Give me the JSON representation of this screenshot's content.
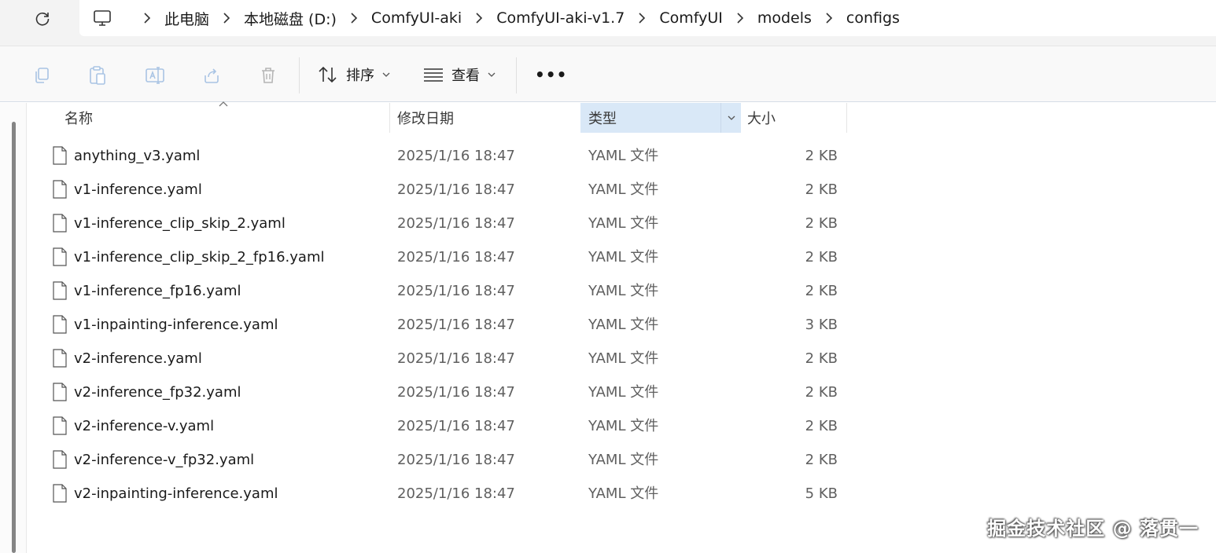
{
  "address_bar": {
    "breadcrumbs": [
      "此电脑",
      "本地磁盘 (D:)",
      "ComfyUI-aki",
      "ComfyUI-aki-v1.7",
      "ComfyUI",
      "models",
      "configs"
    ]
  },
  "toolbar": {
    "icons": [
      "copy-icon",
      "paste-icon",
      "rename-icon",
      "share-icon",
      "delete-icon"
    ],
    "sort_label": "排序",
    "view_label": "查看",
    "more_label": "•••"
  },
  "columns": {
    "name": "名称",
    "date": "修改日期",
    "type": "类型",
    "size": "大小"
  },
  "files": [
    {
      "name": "anything_v3.yaml",
      "date": "2025/1/16 18:47",
      "type": "YAML 文件",
      "size": "2 KB"
    },
    {
      "name": "v1-inference.yaml",
      "date": "2025/1/16 18:47",
      "type": "YAML 文件",
      "size": "2 KB"
    },
    {
      "name": "v1-inference_clip_skip_2.yaml",
      "date": "2025/1/16 18:47",
      "type": "YAML 文件",
      "size": "2 KB"
    },
    {
      "name": "v1-inference_clip_skip_2_fp16.yaml",
      "date": "2025/1/16 18:47",
      "type": "YAML 文件",
      "size": "2 KB"
    },
    {
      "name": "v1-inference_fp16.yaml",
      "date": "2025/1/16 18:47",
      "type": "YAML 文件",
      "size": "2 KB"
    },
    {
      "name": "v1-inpainting-inference.yaml",
      "date": "2025/1/16 18:47",
      "type": "YAML 文件",
      "size": "3 KB"
    },
    {
      "name": "v2-inference.yaml",
      "date": "2025/1/16 18:47",
      "type": "YAML 文件",
      "size": "2 KB"
    },
    {
      "name": "v2-inference_fp32.yaml",
      "date": "2025/1/16 18:47",
      "type": "YAML 文件",
      "size": "2 KB"
    },
    {
      "name": "v2-inference-v.yaml",
      "date": "2025/1/16 18:47",
      "type": "YAML 文件",
      "size": "2 KB"
    },
    {
      "name": "v2-inference-v_fp32.yaml",
      "date": "2025/1/16 18:47",
      "type": "YAML 文件",
      "size": "2 KB"
    },
    {
      "name": "v2-inpainting-inference.yaml",
      "date": "2025/1/16 18:47",
      "type": "YAML 文件",
      "size": "5 KB"
    }
  ],
  "watermark": "掘金技术社区 @ 落贯一",
  "colors": {
    "accent_header": "#d9e8f7",
    "toolbar_bg": "#f9f9f9",
    "addr_bg": "#f3f3f3"
  }
}
